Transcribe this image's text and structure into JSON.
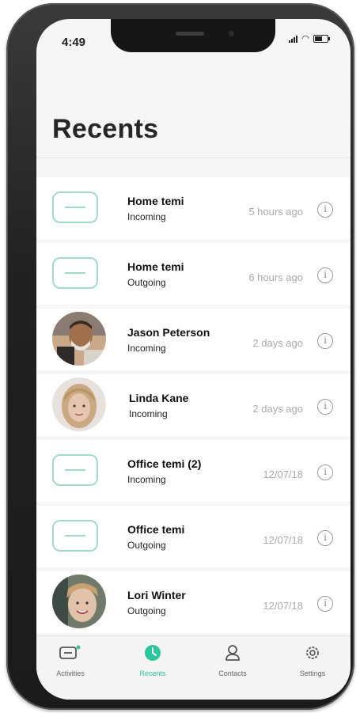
{
  "status_bar": {
    "time": "4:49"
  },
  "header": {
    "title": "Recents"
  },
  "recents": [
    {
      "name": "Home temi",
      "direction": "Incoming",
      "time": "5 hours ago",
      "avatar": "temi-device-icon"
    },
    {
      "name": "Home temi",
      "direction": "Outgoing",
      "time": "6 hours ago",
      "avatar": "temi-device-icon"
    },
    {
      "name": "Jason Peterson",
      "direction": "Incoming",
      "time": "2 days ago",
      "avatar": "photo"
    },
    {
      "name": "Linda Kane",
      "direction": "Incoming",
      "time": "2 days ago",
      "avatar": "photo"
    },
    {
      "name": "Office temi (2)",
      "direction": "Incoming",
      "time": "12/07/18",
      "avatar": "temi-device-icon"
    },
    {
      "name": "Office temi",
      "direction": "Outgoing",
      "time": "12/07/18",
      "avatar": "temi-device-icon"
    },
    {
      "name": "Lori Winter",
      "direction": "Outgoing",
      "time": "12/07/18",
      "avatar": "photo"
    }
  ],
  "tabbar": {
    "activities": "Activities",
    "recents": "Recents",
    "contacts": "Contacts",
    "settings": "Settings",
    "active": "Recents"
  },
  "colors": {
    "accent": "#2cc79e",
    "tile_outline": "#9fdcc9"
  }
}
